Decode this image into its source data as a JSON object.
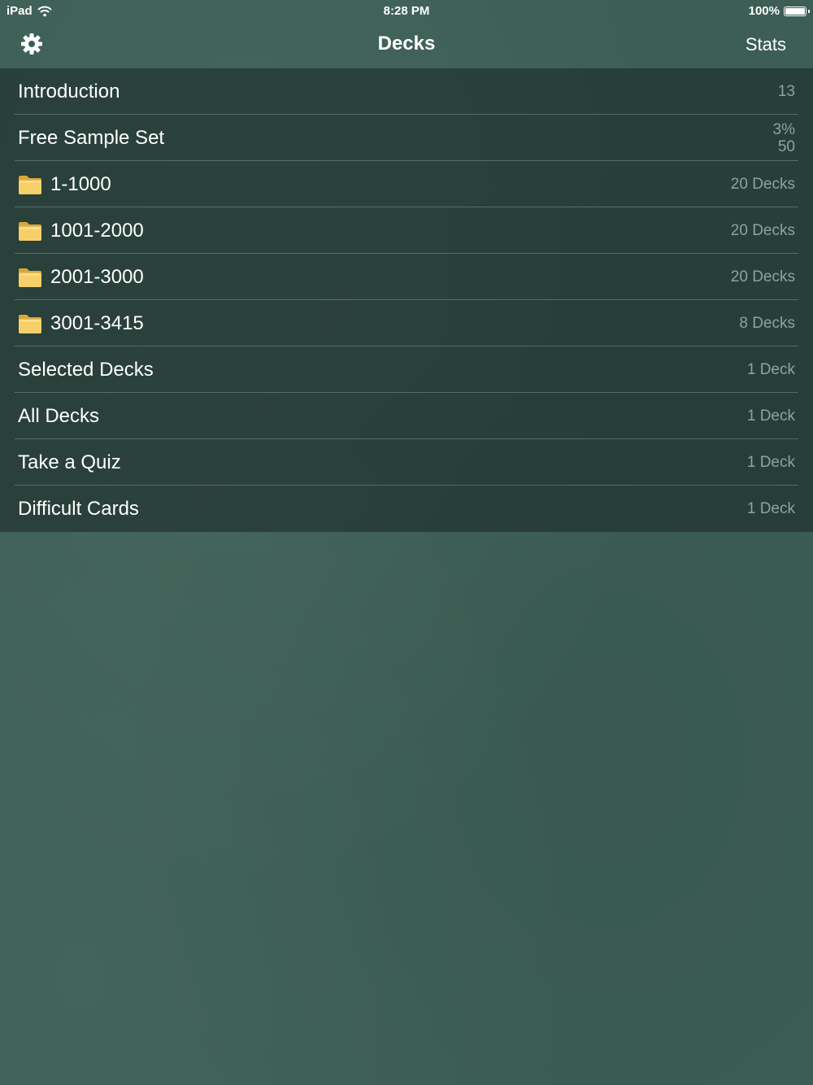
{
  "status_bar": {
    "device": "iPad",
    "time": "8:28 PM",
    "battery": "100%",
    "wifi_icon": "wifi-icon",
    "battery_icon": "battery-icon"
  },
  "nav": {
    "title": "Decks",
    "stats_label": "Stats",
    "settings_icon": "gear-icon"
  },
  "colors": {
    "background": "#3c5e55",
    "list_background": "#24352f",
    "detail_text": "#8fa39d",
    "folder_yellow": "#f7cf68"
  },
  "decks": [
    {
      "name": "Introduction",
      "detail": "13",
      "detail2": "",
      "folder": false
    },
    {
      "name": "Free Sample Set",
      "detail": "3%",
      "detail2": "50",
      "folder": false
    },
    {
      "name": "1-1000",
      "detail": "20 Decks",
      "detail2": "",
      "folder": true
    },
    {
      "name": "1001-2000",
      "detail": "20 Decks",
      "detail2": "",
      "folder": true
    },
    {
      "name": "2001-3000",
      "detail": "20 Decks",
      "detail2": "",
      "folder": true
    },
    {
      "name": "3001-3415",
      "detail": "8 Decks",
      "detail2": "",
      "folder": true
    },
    {
      "name": "Selected Decks",
      "detail": "1 Deck",
      "detail2": "",
      "folder": false
    },
    {
      "name": "All Decks",
      "detail": "1 Deck",
      "detail2": "",
      "folder": false
    },
    {
      "name": "Take a Quiz",
      "detail": "1 Deck",
      "detail2": "",
      "folder": false
    },
    {
      "name": "Difficult Cards",
      "detail": "1 Deck",
      "detail2": "",
      "folder": false
    }
  ]
}
